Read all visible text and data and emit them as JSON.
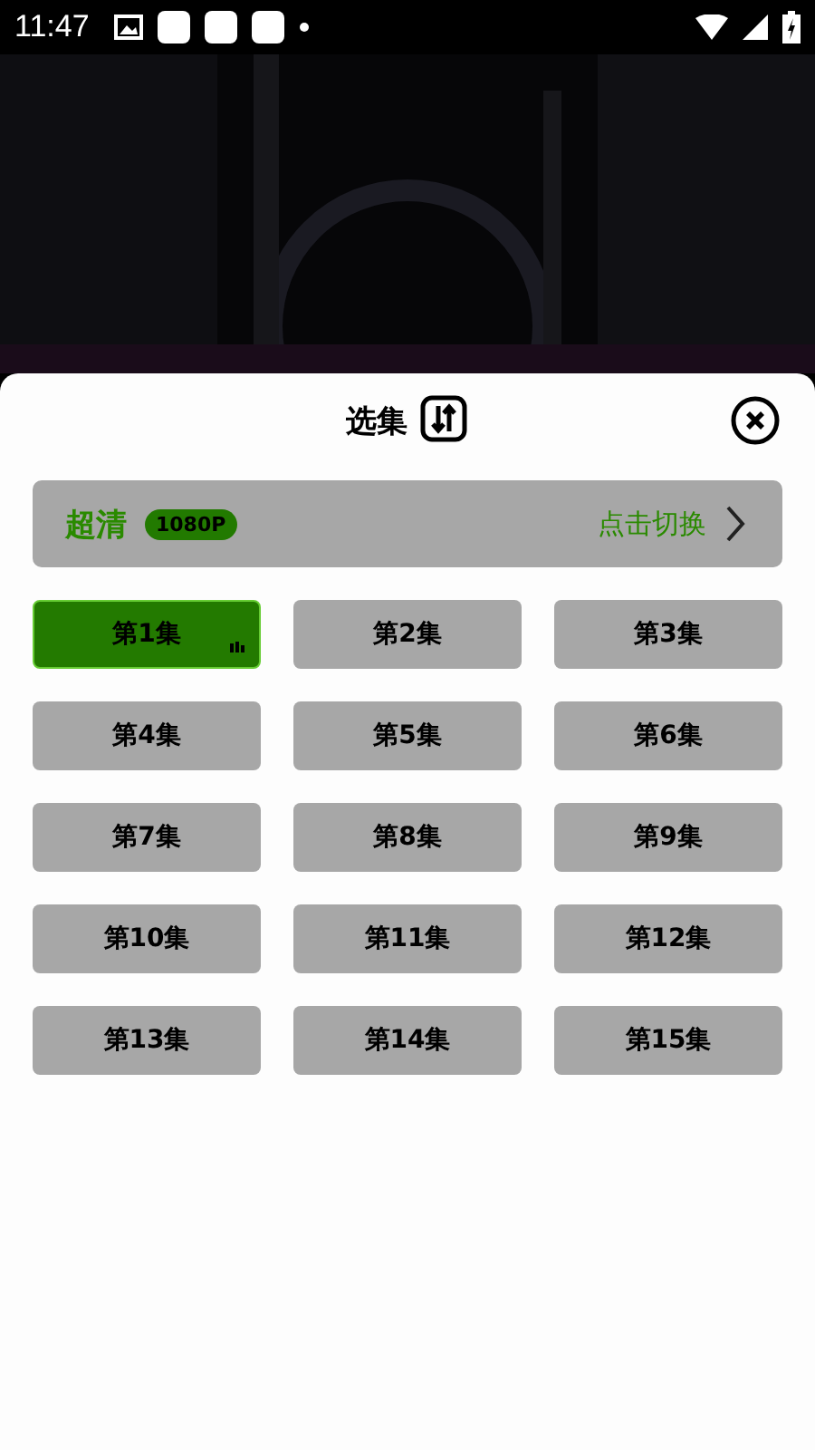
{
  "status_bar": {
    "time": "11:47"
  },
  "sheet": {
    "title": "选集",
    "quality": {
      "label": "超清",
      "badge": "1080P",
      "action": "点击切换"
    }
  },
  "episodes": [
    {
      "label": "第1集",
      "selected": true
    },
    {
      "label": "第2集",
      "selected": false
    },
    {
      "label": "第3集",
      "selected": false
    },
    {
      "label": "第4集",
      "selected": false
    },
    {
      "label": "第5集",
      "selected": false
    },
    {
      "label": "第6集",
      "selected": false
    },
    {
      "label": "第7集",
      "selected": false
    },
    {
      "label": "第8集",
      "selected": false
    },
    {
      "label": "第9集",
      "selected": false
    },
    {
      "label": "第10集",
      "selected": false
    },
    {
      "label": "第11集",
      "selected": false
    },
    {
      "label": "第12集",
      "selected": false
    },
    {
      "label": "第13集",
      "selected": false
    },
    {
      "label": "第14集",
      "selected": false
    },
    {
      "label": "第15集",
      "selected": false
    }
  ]
}
